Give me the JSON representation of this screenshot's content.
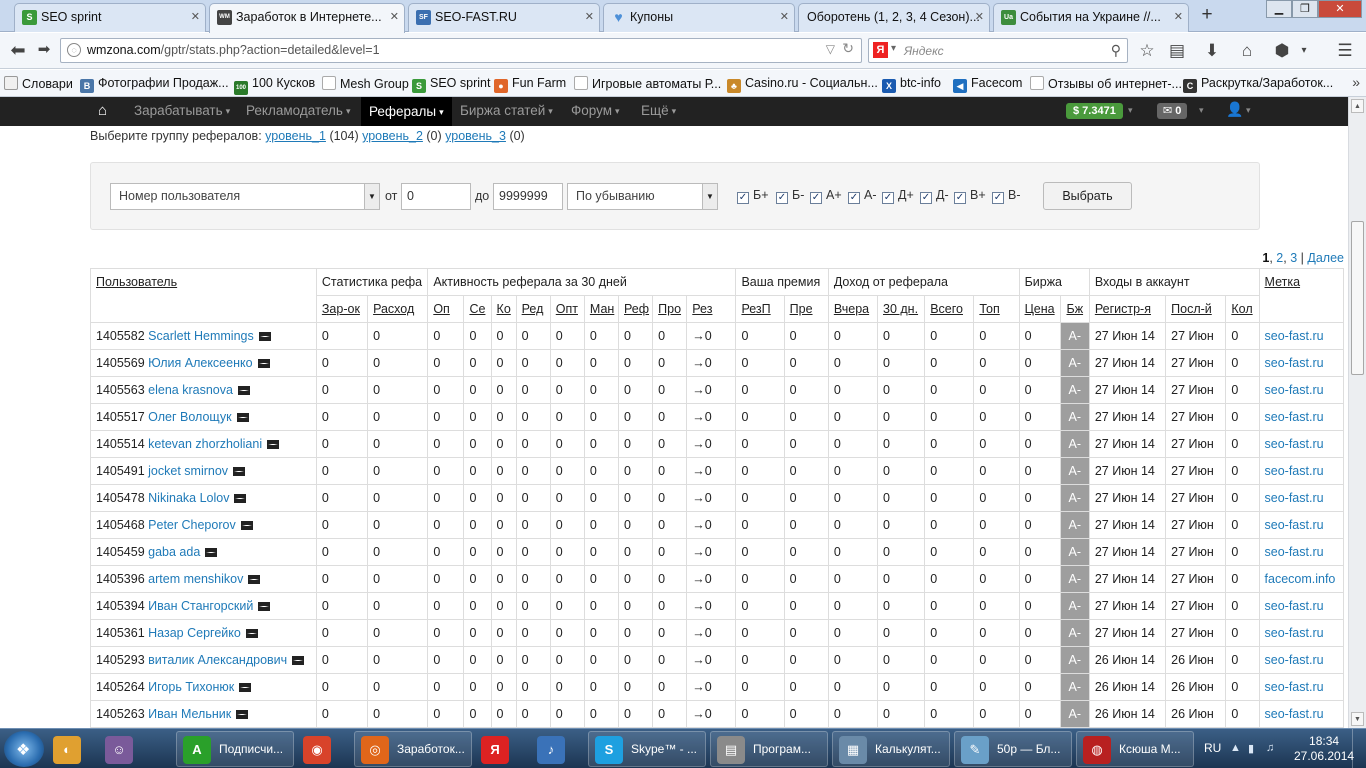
{
  "browser_tabs": [
    {
      "title": "SEO sprint",
      "icon": "S",
      "color": "#3a9a3a",
      "active": false
    },
    {
      "title": "Заработок в Интернете...",
      "icon": "WM",
      "color": "#444",
      "active": true
    },
    {
      "title": "SEO-FAST.RU",
      "icon": "SF",
      "color": "#3b6fb0",
      "active": false
    },
    {
      "title": "Купоны",
      "icon": "♥",
      "color": "#4d90d8",
      "active": false
    },
    {
      "title": "Оборотень (1, 2, 3, 4 Сезон)...",
      "icon": "",
      "color": "#ddd",
      "active": false
    },
    {
      "title": "События на Украине //...",
      "icon": "Ua",
      "color": "#3d8d3d",
      "active": false
    }
  ],
  "address": {
    "domain": "wmzona.com",
    "path": "/gptr/stats.php?action=detailed&level=1"
  },
  "search": {
    "placeholder": "Яндекс",
    "engine": "Я"
  },
  "bookmarks": [
    {
      "label": "Словари",
      "icon": "",
      "color": "#eee"
    },
    {
      "label": "Фотографии Продаж...",
      "icon": "B",
      "color": "#4a76a8"
    },
    {
      "label": "100 Кусков",
      "icon": "100",
      "color": "#2a7a2a"
    },
    {
      "label": "Mesh Group",
      "icon": "",
      "color": "#222"
    },
    {
      "label": "SEO sprint",
      "icon": "S",
      "color": "#3a9a3a"
    },
    {
      "label": "Fun Farm",
      "icon": "●",
      "color": "#e0662a"
    },
    {
      "label": "Игровые автоматы Р...",
      "icon": "",
      "color": "#eee"
    },
    {
      "label": "Casino.ru - Социальн...",
      "icon": "♣",
      "color": "#c9892a"
    },
    {
      "label": "btc-info",
      "icon": "X",
      "color": "#1a5ab0"
    },
    {
      "label": "Facecom",
      "icon": "◀",
      "color": "#1f6fc0"
    },
    {
      "label": "Отзывы об интернет-...",
      "icon": "",
      "color": "#eee"
    },
    {
      "label": "Раскрутка/Заработок...",
      "icon": "C",
      "color": "#333"
    }
  ],
  "site_menu": {
    "items": [
      {
        "label": "Зарабатывать",
        "active": false
      },
      {
        "label": "Рекламодатель",
        "active": false
      },
      {
        "label": "Рефералы",
        "active": true
      },
      {
        "label": "Биржа статей",
        "active": false
      },
      {
        "label": "Форум",
        "active": false
      },
      {
        "label": "Ещё",
        "active": false
      }
    ],
    "balance": "$ 7.3471",
    "messages": "0"
  },
  "groups": {
    "label": "Выберите группу рефералов:",
    "levels": [
      {
        "name": "уровень_1",
        "count": "(104)"
      },
      {
        "name": "уровень_2",
        "count": "(0)"
      },
      {
        "name": "уровень_3",
        "count": "(0)"
      }
    ]
  },
  "filter": {
    "sort_field": "Номер пользователя",
    "from_label": "от",
    "from_value": "0",
    "to_label": "до",
    "to_value": "9999999",
    "order": "По убыванию",
    "checkboxes": [
      "Б+",
      "Б-",
      "А+",
      "А-",
      "Д+",
      "Д-",
      "В+",
      "В-"
    ],
    "submit": "Выбрать"
  },
  "pagination": {
    "current": "1",
    "pages": [
      "2",
      "3"
    ],
    "sep": "|",
    "next": "Далее"
  },
  "table": {
    "groups": [
      "Пользователь",
      "Статистика рефа",
      "Активность реферала за 30 дней",
      "Ваша премия",
      "Доход от реферала",
      "Биржа",
      "Входы в аккаунт",
      "Метка"
    ],
    "subheaders": [
      "Зар-ок",
      "Расход",
      "Оп",
      "Се",
      "Ко",
      "Ред",
      "Опт",
      "Ман",
      "Реф",
      "Про",
      "Рез",
      "РезП",
      "Пре",
      "Вчера",
      "30 дн.",
      "Всего",
      "Топ",
      "Цена",
      "Бж",
      "Регистр-я",
      "Посл-й",
      "Кол"
    ],
    "rows": [
      {
        "id": "1405582",
        "name": "Scarlett Hemmings",
        "reg": "27 Июн 14",
        "last": "27 Июн",
        "tag": "seo-fast.ru"
      },
      {
        "id": "1405569",
        "name": "Юлия Алексеенко",
        "reg": "27 Июн 14",
        "last": "27 Июн",
        "tag": "seo-fast.ru"
      },
      {
        "id": "1405563",
        "name": "elena krasnova",
        "reg": "27 Июн 14",
        "last": "27 Июн",
        "tag": "seo-fast.ru"
      },
      {
        "id": "1405517",
        "name": "Олег Волощук",
        "reg": "27 Июн 14",
        "last": "27 Июн",
        "tag": "seo-fast.ru"
      },
      {
        "id": "1405514",
        "name": "ketevan zhorzholiani",
        "reg": "27 Июн 14",
        "last": "27 Июн",
        "tag": "seo-fast.ru"
      },
      {
        "id": "1405491",
        "name": "jocket smirnov",
        "reg": "27 Июн 14",
        "last": "27 Июн",
        "tag": "seo-fast.ru"
      },
      {
        "id": "1405478",
        "name": "Nikinaka Lolov",
        "reg": "27 Июн 14",
        "last": "27 Июн",
        "tag": "seo-fast.ru"
      },
      {
        "id": "1405468",
        "name": "Peter Cheporov",
        "reg": "27 Июн 14",
        "last": "27 Июн",
        "tag": "seo-fast.ru"
      },
      {
        "id": "1405459",
        "name": "gaba ada",
        "reg": "27 Июн 14",
        "last": "27 Июн",
        "tag": "seo-fast.ru"
      },
      {
        "id": "1405396",
        "name": "artem menshikov",
        "reg": "27 Июн 14",
        "last": "27 Июн",
        "tag": "facecom.info"
      },
      {
        "id": "1405394",
        "name": "Иван Стангорский",
        "reg": "27 Июн 14",
        "last": "27 Июн",
        "tag": "seo-fast.ru"
      },
      {
        "id": "1405361",
        "name": "Назар Сергейко",
        "reg": "27 Июн 14",
        "last": "27 Июн",
        "tag": "seo-fast.ru"
      },
      {
        "id": "1405293",
        "name": "виталик Александрович",
        "reg": "26 Июн 14",
        "last": "26 Июн",
        "tag": "seo-fast.ru"
      },
      {
        "id": "1405264",
        "name": "Игорь Тихонюк",
        "reg": "26 Июн 14",
        "last": "26 Июн",
        "tag": "seo-fast.ru"
      },
      {
        "id": "1405263",
        "name": "Иван Мельник",
        "reg": "26 Июн 14",
        "last": "26 Июн",
        "tag": "seo-fast.ru"
      }
    ],
    "zero": "0",
    "result_value": "→0",
    "exchange_value": "А-"
  },
  "taskbar": {
    "items": [
      {
        "label": "",
        "icon": "◐",
        "color": "#e0a030"
      },
      {
        "label": "",
        "icon": "☺",
        "color": "#7a5a9a"
      },
      {
        "label": "Подписчи...",
        "icon": "A",
        "color": "#2aa02a"
      },
      {
        "label": "",
        "icon": "◉",
        "color": "#d8432a"
      },
      {
        "label": "Заработок...",
        "icon": "◎",
        "color": "#e0661a"
      },
      {
        "label": "",
        "icon": "Я",
        "color": "#d22"
      },
      {
        "label": "",
        "icon": "♪",
        "color": "#3a72b8"
      },
      {
        "label": "Skype™ - ...",
        "icon": "S",
        "color": "#1ea0e0"
      },
      {
        "label": "Програм...",
        "icon": "▤",
        "color": "#8a8a8a"
      },
      {
        "label": "Калькулят...",
        "icon": "▦",
        "color": "#6a8aa8"
      },
      {
        "label": "50р — Бл...",
        "icon": "✎",
        "color": "#6aa0c8"
      },
      {
        "label": "Ксюша М...",
        "icon": "◍",
        "color": "#b82020"
      }
    ],
    "lang": "RU",
    "time": "18:34",
    "date": "27.06.2014"
  }
}
